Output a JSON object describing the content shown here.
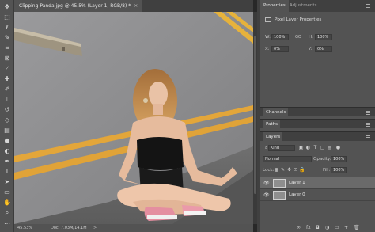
{
  "document": {
    "tab_title": "Clipping Panda.jpg @ 45.5% (Layer 1, RGB/8) *",
    "close_glyph": "×"
  },
  "statusbar": {
    "zoom": "45.53%",
    "doc_info": "Doc: 7.03M/14.1M",
    "arrow": ">"
  },
  "toolbar": {
    "tools": [
      "move-tool",
      "marquee-tool",
      "lasso-tool",
      "quick-select-tool",
      "crop-tool",
      "frame-tool",
      "eyedropper-tool",
      "healing-brush-tool",
      "brush-tool",
      "clone-stamp-tool",
      "history-brush-tool",
      "eraser-tool",
      "gradient-tool",
      "blur-tool",
      "dodge-tool",
      "pen-tool",
      "type-tool",
      "path-select-tool",
      "rectangle-tool",
      "hand-tool",
      "zoom-tool"
    ]
  },
  "properties_panel": {
    "tabs": [
      "Properties",
      "Adjustments"
    ],
    "section_title": "Pixel Layer Properties",
    "w_label": "W:",
    "w_value": "100%",
    "h_label": "H:",
    "h_value": "100%",
    "link_label": "GO",
    "x_label": "X:",
    "x_value": "0%",
    "y_label": "Y:",
    "y_value": "0%"
  },
  "channels_panel": {
    "title": "Channels"
  },
  "paths_panel": {
    "title": "Paths"
  },
  "layers_panel": {
    "title": "Layers",
    "filter_kind": "Kind",
    "blend_mode": "Normal",
    "opacity_label": "Opacity:",
    "opacity_value": "100%",
    "lock_label": "Lock:",
    "fill_label": "Fill:",
    "fill_value": "100%",
    "layers": [
      {
        "name": "Layer 1",
        "selected": true
      },
      {
        "name": "Layer 0",
        "selected": false
      }
    ],
    "footer_icons": [
      "link-layers-icon",
      "fx-icon",
      "layer-mask-icon",
      "adjustment-layer-icon",
      "group-icon",
      "new-layer-icon",
      "delete-icon"
    ],
    "footer_glyphs": [
      "∞",
      "fx",
      "◘",
      "◑",
      "▭",
      "+",
      "🗑"
    ]
  },
  "colors": {
    "panel_bg": "#535353",
    "dark_bg": "#404040",
    "canvas_wall": "#8d8d8f",
    "yellow_stripe": "#e3a63a"
  }
}
